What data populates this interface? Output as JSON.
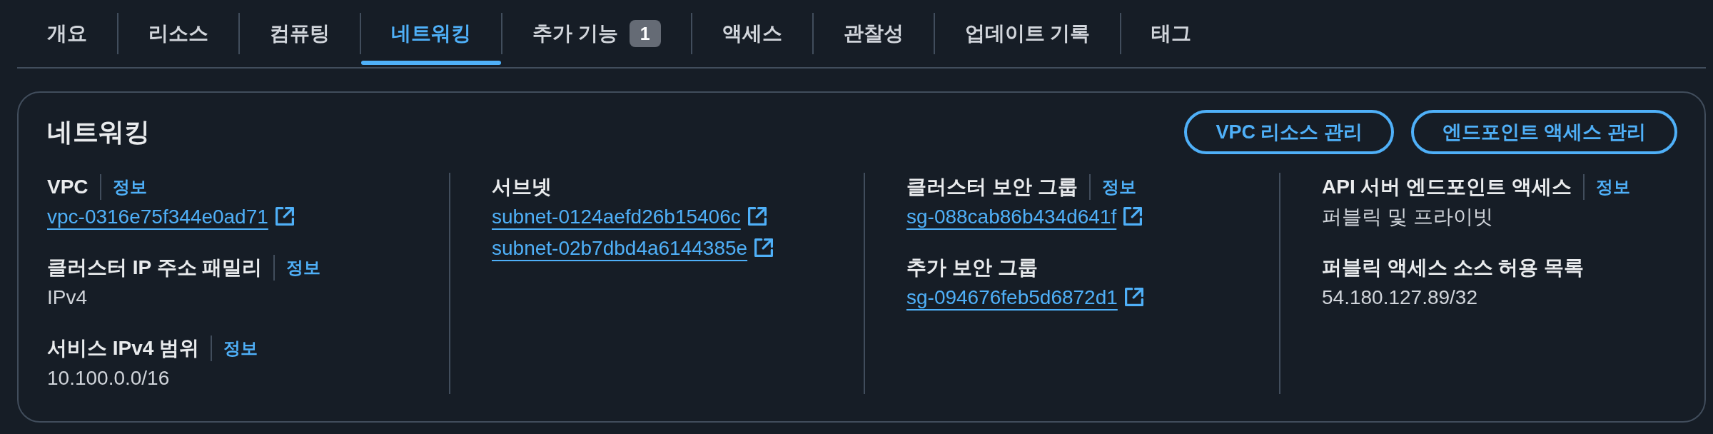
{
  "tabs": [
    {
      "label": "개요",
      "selected": false
    },
    {
      "label": "리소스",
      "selected": false
    },
    {
      "label": "컴퓨팅",
      "selected": false
    },
    {
      "label": "네트워킹",
      "selected": true
    },
    {
      "label": "추가 기능",
      "selected": false,
      "badge": "1"
    },
    {
      "label": "액세스",
      "selected": false
    },
    {
      "label": "관찰성",
      "selected": false
    },
    {
      "label": "업데이트 기록",
      "selected": false
    },
    {
      "label": "태그",
      "selected": false
    }
  ],
  "panel": {
    "title": "네트워킹",
    "actions": [
      {
        "label": "VPC 리소스 관리"
      },
      {
        "label": "엔드포인트 액세스 관리"
      }
    ],
    "columns": [
      {
        "fields": [
          {
            "label": "VPC",
            "info": "정보",
            "values": [
              {
                "kind": "external-link",
                "text": "vpc-0316e75f344e0ad71"
              }
            ]
          },
          {
            "label": "클러스터 IP 주소 패밀리",
            "info": "정보",
            "values": [
              {
                "kind": "text",
                "text": "IPv4"
              }
            ]
          },
          {
            "label": "서비스 IPv4 범위",
            "info": "정보",
            "values": [
              {
                "kind": "text",
                "text": "10.100.0.0/16"
              }
            ]
          }
        ]
      },
      {
        "fields": [
          {
            "label": "서브넷",
            "values": [
              {
                "kind": "external-link",
                "text": "subnet-0124aefd26b15406c"
              },
              {
                "kind": "external-link",
                "text": "subnet-02b7dbd4a6144385e"
              }
            ]
          }
        ]
      },
      {
        "fields": [
          {
            "label": "클러스터 보안 그룹",
            "info": "정보",
            "values": [
              {
                "kind": "external-link",
                "text": "sg-088cab86b434d641f"
              }
            ]
          },
          {
            "label": "추가 보안 그룹",
            "values": [
              {
                "kind": "external-link",
                "text": "sg-094676feb5d6872d1"
              }
            ]
          }
        ]
      },
      {
        "fields": [
          {
            "label": "API 서버 엔드포인트 액세스",
            "info": "정보",
            "values": [
              {
                "kind": "text",
                "text": "퍼블릭 및 프라이빗"
              }
            ]
          },
          {
            "label": "퍼블릭 액세스 소스 허용 목록",
            "values": [
              {
                "kind": "text",
                "text": "54.180.127.89/32"
              }
            ]
          }
        ]
      }
    ]
  }
}
